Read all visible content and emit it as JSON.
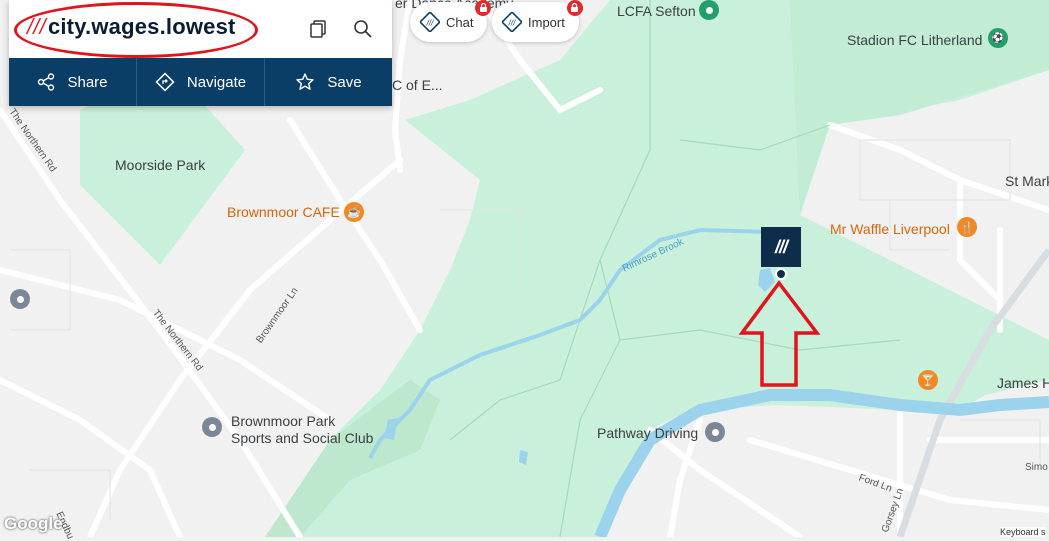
{
  "card": {
    "address_prefix": "///",
    "address": "city.wages.lowest",
    "actions": [
      {
        "label": "Share",
        "icon": "share-icon"
      },
      {
        "label": "Navigate",
        "icon": "navigate-icon"
      },
      {
        "label": "Save",
        "icon": "star-icon"
      }
    ]
  },
  "top_buttons": {
    "chat": {
      "label": "Chat",
      "icon": "chat-icon",
      "locked": true
    },
    "import": {
      "label": "Import",
      "icon": "import-icon",
      "locked": true
    }
  },
  "marker": {
    "label": "///"
  },
  "map_labels": {
    "moorside_park": "Moorside Park",
    "brownmoor_cafe": "Brownmoor CAFE",
    "lcfa_sefton": "LCFA Sefton",
    "stadion_fc": "Stadion FC Litherland",
    "mr_waffle": "Mr Waffle Liverpool",
    "st_mark": "St Mark",
    "james": "James H",
    "brownmoor_park_line1": "Brownmoor Park",
    "brownmoor_park_line2": "Sports and Social Club",
    "pathway_driving": "Pathway Driving",
    "dance_academy": "er Dance Academy",
    "c_of_e": "C of E...",
    "rimrose_brook": "Rimrose Brook",
    "the_northern_rd_1": "The Northern Rd",
    "the_northern_rd_2": "The Northern Rd",
    "brownmoor_ln": "Brownmoor Ln",
    "ford_ln": "Ford Ln",
    "gorsey_ln": "Gorsey Ln",
    "simo": "Simo",
    "endbu": "Endbu",
    "google": "Google",
    "keyboard": "Keyboard s"
  },
  "colors": {
    "park_green": "#c9f0da",
    "water_blue": "#9cd3ec",
    "header_navy": "#0b3e66",
    "annotation_red": "#e0141b",
    "poi_orange": "#f08a24",
    "poi_green": "#22a06b"
  }
}
